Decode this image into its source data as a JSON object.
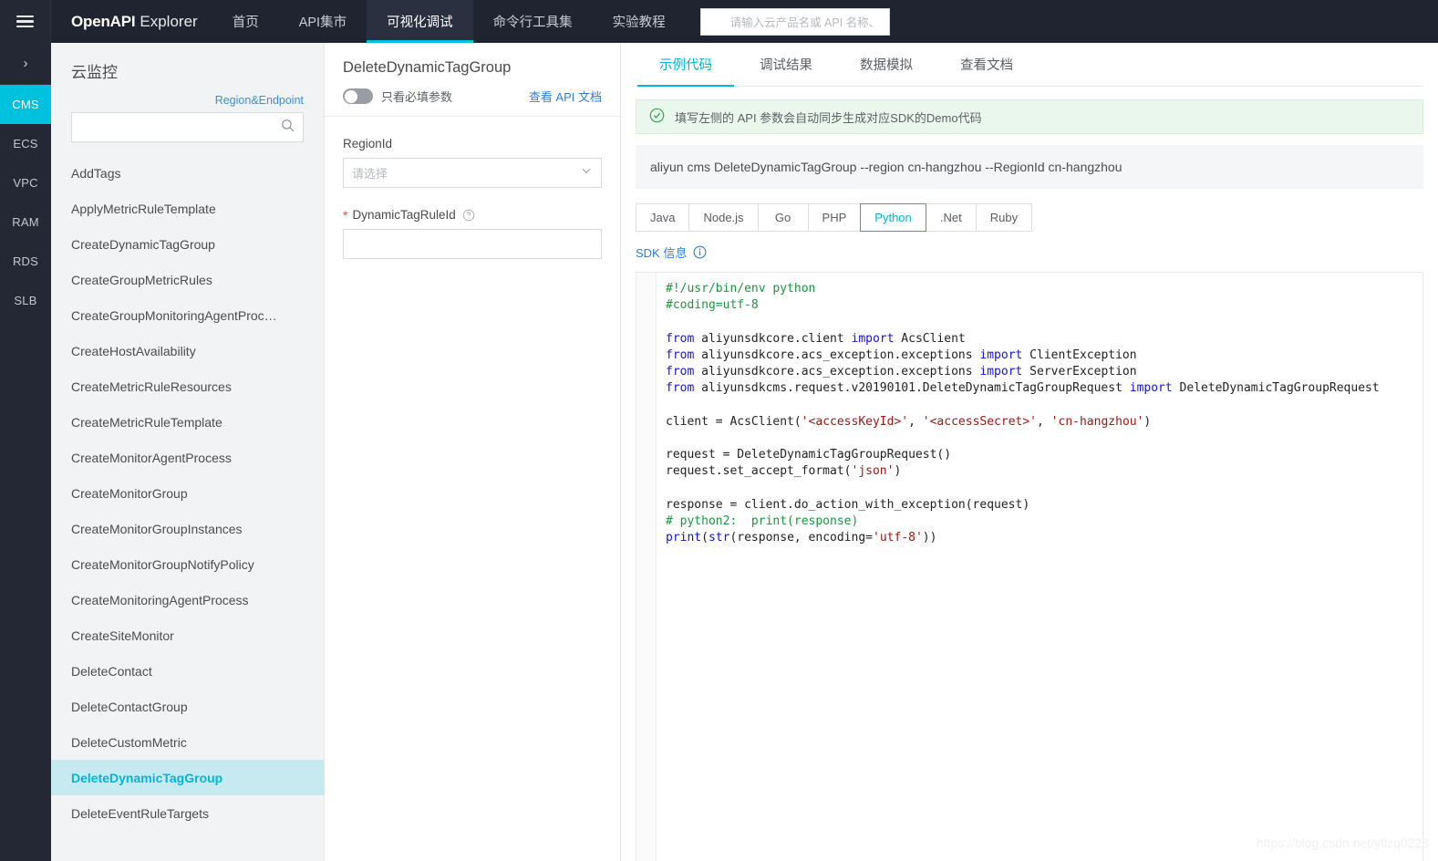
{
  "topbar": {
    "menu_icon": "hamburger-icon",
    "brand_bold": "OpenAPI",
    "brand_light": "Explorer",
    "nav": [
      {
        "label": "首页",
        "active": false
      },
      {
        "label": "API集市",
        "active": false
      },
      {
        "label": "可视化调试",
        "active": true
      },
      {
        "label": "命令行工具集",
        "active": false
      },
      {
        "label": "实验教程",
        "active": false
      }
    ],
    "search": {
      "icon": "search-icon",
      "placeholder": "请输入云产品名或 API 名称、",
      "value": ""
    }
  },
  "rail": {
    "expand_icon": "chevron-right-icon",
    "items": [
      {
        "label": "CMS",
        "active": true
      },
      {
        "label": "ECS",
        "active": false
      },
      {
        "label": "VPC",
        "active": false
      },
      {
        "label": "RAM",
        "active": false
      },
      {
        "label": "RDS",
        "active": false
      },
      {
        "label": "SLB",
        "active": false
      }
    ]
  },
  "api_list": {
    "product_title": "云监控",
    "region_endpoint_link": "Region&Endpoint",
    "search": {
      "icon": "search-icon",
      "value": "",
      "placeholder": ""
    },
    "items": [
      {
        "label": "AddTags",
        "active": false
      },
      {
        "label": "ApplyMetricRuleTemplate",
        "active": false
      },
      {
        "label": "CreateDynamicTagGroup",
        "active": false
      },
      {
        "label": "CreateGroupMetricRules",
        "active": false
      },
      {
        "label": "CreateGroupMonitoringAgentProc…",
        "active": false
      },
      {
        "label": "CreateHostAvailability",
        "active": false
      },
      {
        "label": "CreateMetricRuleResources",
        "active": false
      },
      {
        "label": "CreateMetricRuleTemplate",
        "active": false
      },
      {
        "label": "CreateMonitorAgentProcess",
        "active": false
      },
      {
        "label": "CreateMonitorGroup",
        "active": false
      },
      {
        "label": "CreateMonitorGroupInstances",
        "active": false
      },
      {
        "label": "CreateMonitorGroupNotifyPolicy",
        "active": false
      },
      {
        "label": "CreateMonitoringAgentProcess",
        "active": false
      },
      {
        "label": "CreateSiteMonitor",
        "active": false
      },
      {
        "label": "DeleteContact",
        "active": false
      },
      {
        "label": "DeleteContactGroup",
        "active": false
      },
      {
        "label": "DeleteCustomMetric",
        "active": false
      },
      {
        "label": "DeleteDynamicTagGroup",
        "active": true
      },
      {
        "label": "DeleteEventRuleTargets",
        "active": false
      }
    ]
  },
  "params": {
    "title": "DeleteDynamicTagGroup",
    "toggle_label": "只看必填参数",
    "toggle_on": false,
    "doc_link": "查看 API 文档",
    "fields": [
      {
        "name": "RegionId",
        "label": "RegionId",
        "required": false,
        "type": "select",
        "placeholder": "请选择",
        "value": "",
        "help": false
      },
      {
        "name": "DynamicTagRuleId",
        "label": "DynamicTagRuleId",
        "required": true,
        "type": "text",
        "placeholder": "",
        "value": "",
        "help": true
      }
    ]
  },
  "right": {
    "tabs": [
      {
        "label": "示例代码",
        "active": true
      },
      {
        "label": "调试结果",
        "active": false
      },
      {
        "label": "数据模拟",
        "active": false
      },
      {
        "label": "查看文档",
        "active": false
      }
    ],
    "notice": {
      "icon": "success-check-icon",
      "text": "填写左侧的 API 参数会自动同步生成对应SDK的Demo代码"
    },
    "command": "aliyun cms DeleteDynamicTagGroup --region cn-hangzhou --RegionId cn-hangzhou",
    "languages": [
      {
        "label": "Java",
        "active": false
      },
      {
        "label": "Node.js",
        "active": false
      },
      {
        "label": "Go",
        "active": false
      },
      {
        "label": "PHP",
        "active": false
      },
      {
        "label": "Python",
        "active": true
      },
      {
        "label": ".Net",
        "active": false
      },
      {
        "label": "Ruby",
        "active": false
      }
    ],
    "sdk_info_label": "SDK 信息",
    "sdk_info_icon": "info-circle-icon",
    "code_language": "Python",
    "code_tokens": [
      [
        {
          "t": "#!/usr/bin/env python",
          "c": "com"
        }
      ],
      [
        {
          "t": "#coding=utf-8",
          "c": "com"
        }
      ],
      [],
      [
        {
          "t": "from",
          "c": "kw"
        },
        {
          "t": " aliyunsdkcore.client ",
          "c": ""
        },
        {
          "t": "import",
          "c": "kw"
        },
        {
          "t": " AcsClient",
          "c": ""
        }
      ],
      [
        {
          "t": "from",
          "c": "kw"
        },
        {
          "t": " aliyunsdkcore.acs_exception.exceptions ",
          "c": ""
        },
        {
          "t": "import",
          "c": "kw"
        },
        {
          "t": " ClientException",
          "c": ""
        }
      ],
      [
        {
          "t": "from",
          "c": "kw"
        },
        {
          "t": " aliyunsdkcore.acs_exception.exceptions ",
          "c": ""
        },
        {
          "t": "import",
          "c": "kw"
        },
        {
          "t": " ServerException",
          "c": ""
        }
      ],
      [
        {
          "t": "from",
          "c": "kw"
        },
        {
          "t": " aliyunsdkcms.request.v20190101.DeleteDynamicTagGroupRequest ",
          "c": ""
        },
        {
          "t": "import",
          "c": "kw"
        },
        {
          "t": " DeleteDynamicTagGroupRequest",
          "c": ""
        }
      ],
      [],
      [
        {
          "t": "client = AcsClient(",
          "c": ""
        },
        {
          "t": "'<accessKeyId>'",
          "c": "str"
        },
        {
          "t": ", ",
          "c": ""
        },
        {
          "t": "'<accessSecret>'",
          "c": "str"
        },
        {
          "t": ", ",
          "c": ""
        },
        {
          "t": "'cn-hangzhou'",
          "c": "str"
        },
        {
          "t": ")",
          "c": ""
        }
      ],
      [],
      [
        {
          "t": "request = DeleteDynamicTagGroupRequest()",
          "c": ""
        }
      ],
      [
        {
          "t": "request.set_accept_format(",
          "c": ""
        },
        {
          "t": "'json'",
          "c": "str"
        },
        {
          "t": ")",
          "c": ""
        }
      ],
      [],
      [
        {
          "t": "response = client.do_action_with_exception(request)",
          "c": ""
        }
      ],
      [
        {
          "t": "# python2:  print(response)",
          "c": "com"
        }
      ],
      [
        {
          "t": "print",
          "c": "bi"
        },
        {
          "t": "(",
          "c": ""
        },
        {
          "t": "str",
          "c": "bi"
        },
        {
          "t": "(response, encoding=",
          "c": ""
        },
        {
          "t": "'utf-8'",
          "c": "str"
        },
        {
          "t": "))",
          "c": ""
        }
      ]
    ]
  },
  "watermark": "https://blog.csdn.net/ytlzq0228",
  "colors": {
    "accent": "#00b6d4",
    "topbar_bg": "#1f2430",
    "rail_bg": "#232834",
    "link": "#2f7fd8",
    "required": "#e8503a",
    "notice_bg": "#e9f7ec",
    "list_bg": "#f2f3f5",
    "active_list_bg": "#c7eaf1"
  }
}
